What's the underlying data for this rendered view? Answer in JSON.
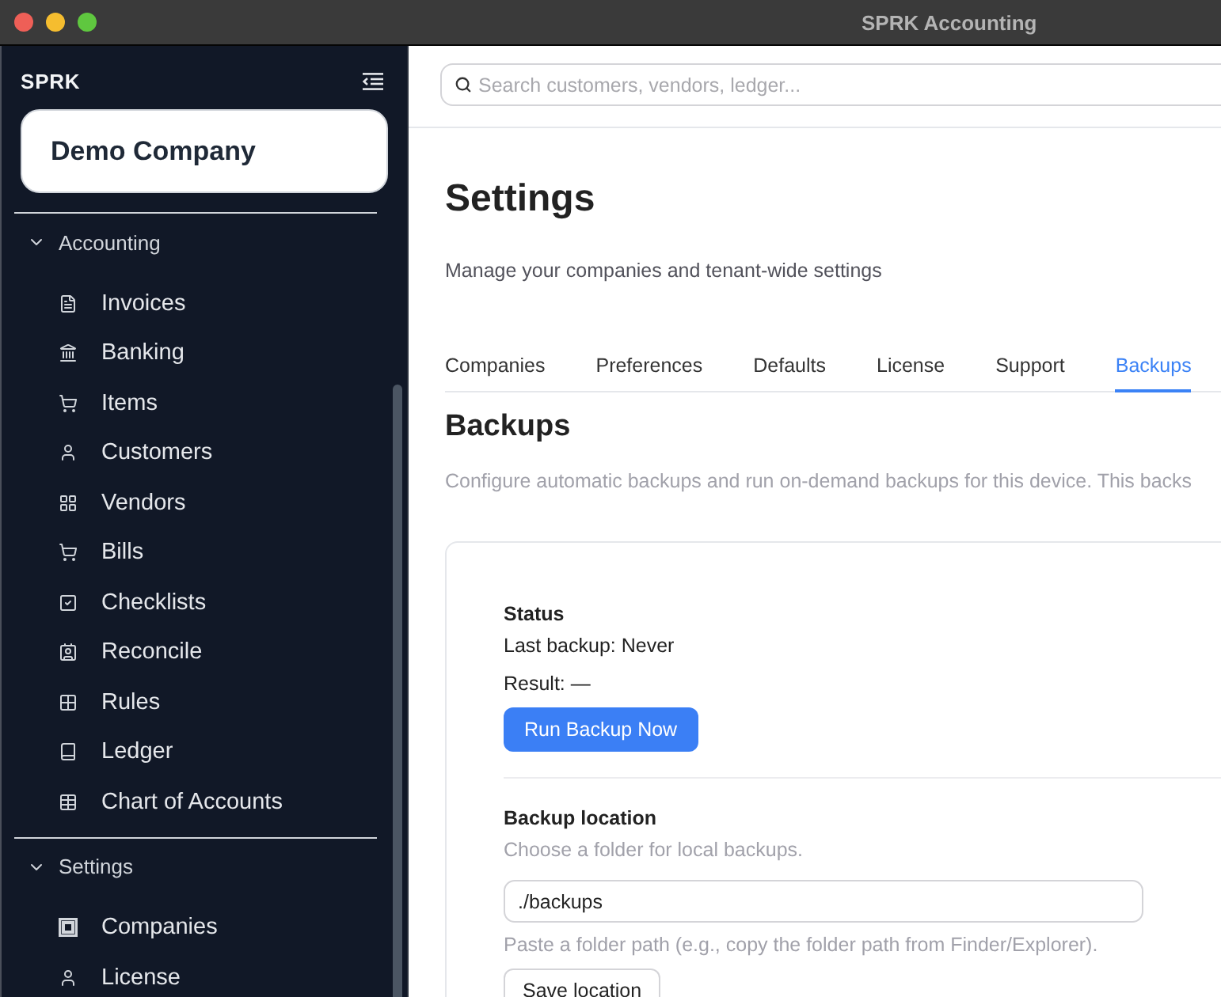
{
  "window": {
    "title": "SPRK Accounting"
  },
  "sidebar": {
    "brand": "SPRK",
    "company": "Demo Company",
    "sections": [
      {
        "label": "Accounting",
        "expanded": true,
        "items": [
          {
            "label": "Invoices",
            "selected": false
          },
          {
            "label": "Banking",
            "selected": false
          },
          {
            "label": "Items",
            "selected": false
          },
          {
            "label": "Customers",
            "selected": false
          },
          {
            "label": "Vendors",
            "selected": false
          },
          {
            "label": "Bills",
            "selected": false
          },
          {
            "label": "Checklists",
            "selected": false
          },
          {
            "label": "Reconcile",
            "selected": false
          },
          {
            "label": "Rules",
            "selected": false
          },
          {
            "label": "Ledger",
            "selected": false
          },
          {
            "label": "Chart of Accounts",
            "selected": false
          }
        ]
      },
      {
        "label": "Settings",
        "expanded": true,
        "items": [
          {
            "label": "Companies",
            "selected": false
          },
          {
            "label": "License",
            "selected": false
          }
        ]
      }
    ]
  },
  "search": {
    "placeholder": "Search customers, vendors, ledger..."
  },
  "page": {
    "title": "Settings",
    "subtitle": "Manage your companies and tenant-wide settings"
  },
  "tabs": [
    {
      "label": "Companies",
      "selected": false
    },
    {
      "label": "Preferences",
      "selected": false
    },
    {
      "label": "Defaults",
      "selected": false
    },
    {
      "label": "License",
      "selected": false
    },
    {
      "label": "Support",
      "selected": false
    },
    {
      "label": "Backups",
      "selected": true
    }
  ],
  "panel": {
    "title": "Backups",
    "description": "Configure automatic backups and run on-demand backups for this device. This backs",
    "status": {
      "heading": "Status",
      "last_backup": "Last backup: Never",
      "result": "Result: —",
      "button": "Run Backup Now"
    },
    "location": {
      "heading": "Backup location",
      "hint": "Choose a folder for local backups.",
      "value": "./backups",
      "help": "Paste a folder path (e.g., copy the folder path from Finder/Explorer).",
      "button": "Save location"
    }
  }
}
